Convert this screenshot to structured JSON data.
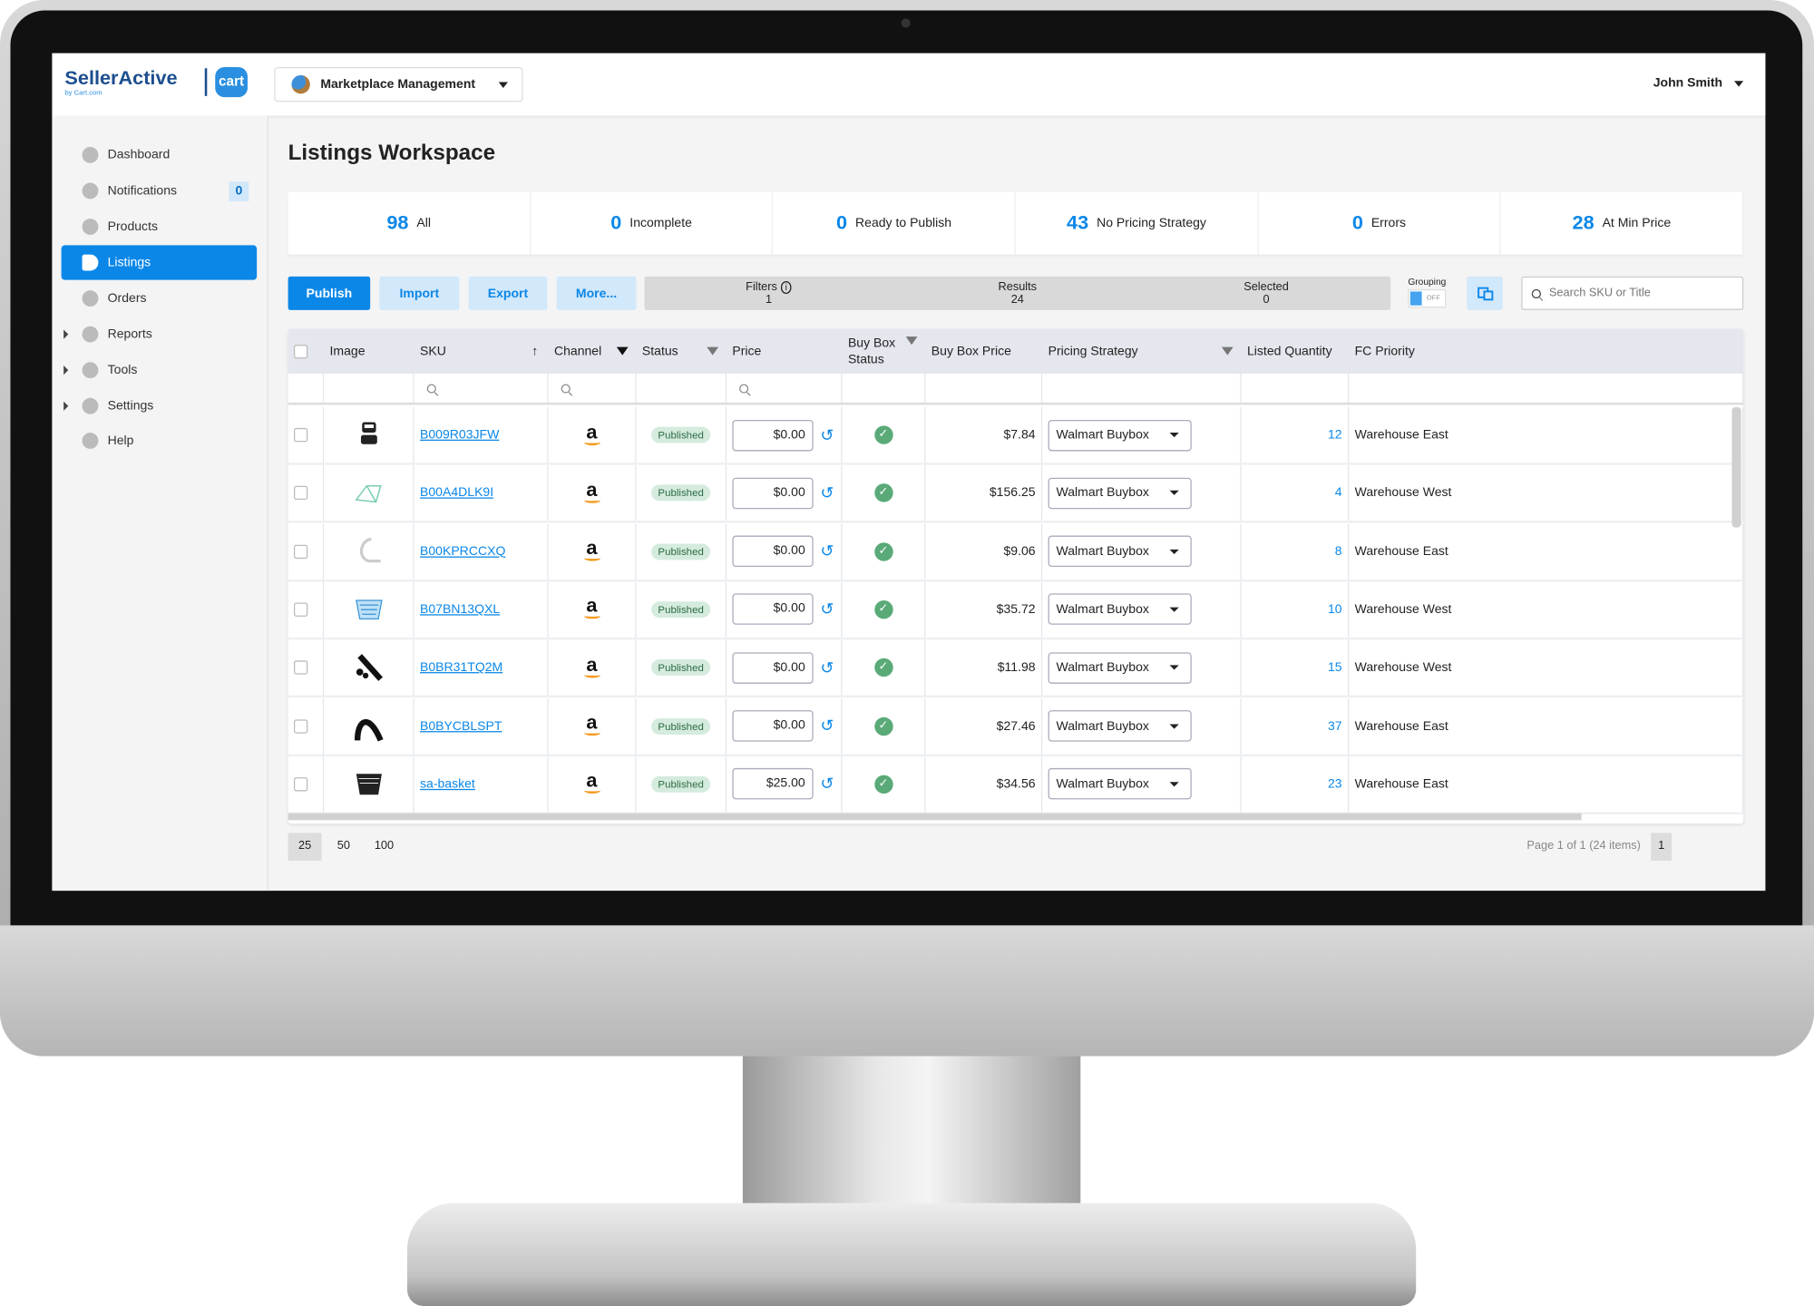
{
  "app": {
    "logo": "SellerActive",
    "logo_sub": "by Cart.com",
    "partner_logo": "cart",
    "module": "Marketplace Management",
    "user": "John Smith"
  },
  "sidebar": {
    "items": [
      {
        "label": "Dashboard",
        "icon": "dashboard-icon"
      },
      {
        "label": "Notifications",
        "icon": "bell-icon",
        "badge": "0"
      },
      {
        "label": "Products",
        "icon": "box-icon"
      },
      {
        "label": "Listings",
        "icon": "tag-icon",
        "active": true
      },
      {
        "label": "Orders",
        "icon": "cart-icon"
      },
      {
        "label": "Reports",
        "icon": "report-icon",
        "expandable": true
      },
      {
        "label": "Tools",
        "icon": "tools-icon",
        "expandable": true
      },
      {
        "label": "Settings",
        "icon": "gear-icon",
        "expandable": true
      },
      {
        "label": "Help",
        "icon": "help-icon"
      }
    ]
  },
  "page": {
    "title": "Listings Workspace"
  },
  "stats": [
    {
      "count": "98",
      "label": "All"
    },
    {
      "count": "0",
      "label": "Incomplete"
    },
    {
      "count": "0",
      "label": "Ready to Publish"
    },
    {
      "count": "43",
      "label": "No Pricing Strategy"
    },
    {
      "count": "0",
      "label": "Errors"
    },
    {
      "count": "28",
      "label": "At Min Price"
    }
  ],
  "toolbar": {
    "publish": "Publish",
    "import": "Import",
    "export": "Export",
    "more": "More...",
    "filters_label": "Filters",
    "filters_value": "1",
    "results_label": "Results",
    "results_value": "24",
    "selected_label": "Selected",
    "selected_value": "0",
    "grouping_label": "Grouping",
    "grouping_state": "OFF",
    "search_placeholder": "Search SKU or Title"
  },
  "table": {
    "columns": [
      "Image",
      "SKU",
      "Channel",
      "Status",
      "Price",
      "Buy Box Status",
      "Buy Box Price",
      "Pricing Strategy",
      "Listed Quantity",
      "FC Priority"
    ],
    "rows": [
      {
        "image": "bike-pedal",
        "sku": "B009R03JFW",
        "channel": "a",
        "status": "Published",
        "price": "$0.00",
        "buybox_price": "$7.84",
        "strategy": "Walmart Buybox",
        "qty": "12",
        "fc": "Warehouse East"
      },
      {
        "image": "bike-frame",
        "sku": "B00A4DLK9I",
        "channel": "a",
        "status": "Published",
        "price": "$0.00",
        "buybox_price": "$156.25",
        "strategy": "Walmart Buybox",
        "qty": "4",
        "fc": "Warehouse West"
      },
      {
        "image": "handlebar",
        "sku": "B00KPRCCXQ",
        "channel": "a",
        "status": "Published",
        "price": "$0.00",
        "buybox_price": "$9.06",
        "strategy": "Walmart Buybox",
        "qty": "8",
        "fc": "Warehouse East"
      },
      {
        "image": "blue-basket",
        "sku": "B07BN13QXL",
        "channel": "a",
        "status": "Published",
        "price": "$0.00",
        "buybox_price": "$35.72",
        "strategy": "Walmart Buybox",
        "qty": "10",
        "fc": "Warehouse West"
      },
      {
        "image": "pump-kit",
        "sku": "B0BR31TQ2M",
        "channel": "a",
        "status": "Published",
        "price": "$0.00",
        "buybox_price": "$11.98",
        "strategy": "Walmart Buybox",
        "qty": "15",
        "fc": "Warehouse West"
      },
      {
        "image": "tire",
        "sku": "B0BYCBLSPT",
        "channel": "a",
        "status": "Published",
        "price": "$0.00",
        "buybox_price": "$27.46",
        "strategy": "Walmart Buybox",
        "qty": "37",
        "fc": "Warehouse East"
      },
      {
        "image": "black-basket",
        "sku": "sa-basket",
        "channel": "a",
        "status": "Published",
        "price": "$25.00",
        "buybox_price": "$34.56",
        "strategy": "Walmart Buybox",
        "qty": "23",
        "fc": "Warehouse East"
      }
    ]
  },
  "pager": {
    "sizes": [
      "25",
      "50",
      "100"
    ],
    "selected_size": "25",
    "summary": "Page 1 of 1 (24 items)",
    "page": "1"
  },
  "colors": {
    "accent": "#0b87e8",
    "published_bg": "#d4ebdd",
    "check": "#5aaa78"
  }
}
